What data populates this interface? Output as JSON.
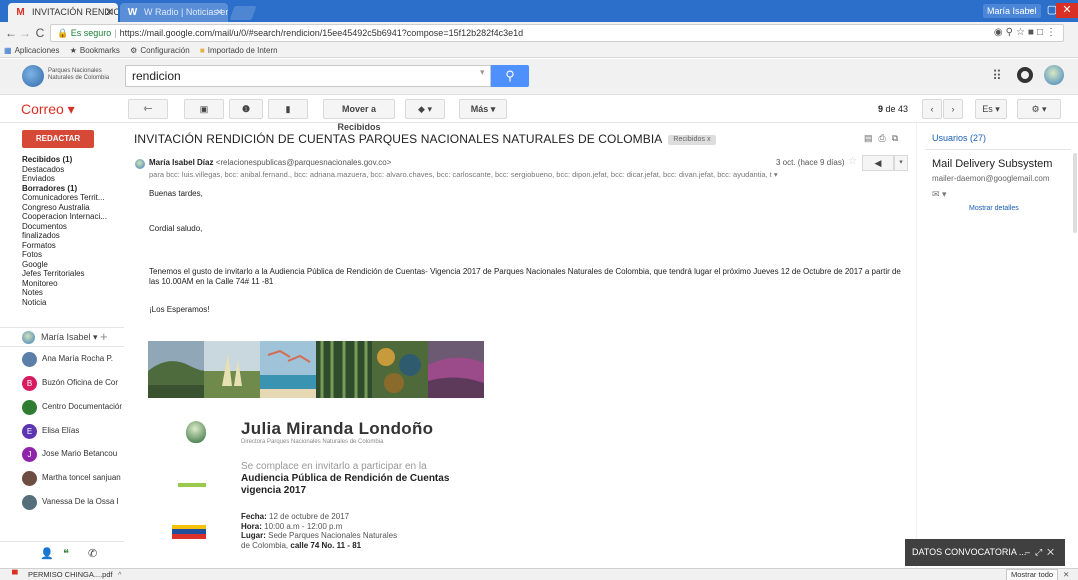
{
  "browser": {
    "tabs": [
      {
        "title": "INVITACIÓN RENDICIÓ",
        "favicon": "M"
      },
      {
        "title": "W Radio | Noticias en Co",
        "favicon": "W"
      }
    ],
    "profile": "María Isabel",
    "window_controls": [
      "–",
      "▢",
      "✕"
    ],
    "secure_label": "Es seguro",
    "url": "https://mail.google.com/mail/u/0/#search/rendicion/15ee45492c5b6941?compose=15f12b282f4c3e1d",
    "bookmarks": [
      "Aplicaciones",
      "Bookmarks",
      "Configuración",
      "Importado de Intern"
    ]
  },
  "gmail": {
    "logo_text": "Parques Nacionales Naturales de Colombia",
    "search_value": "rendicion",
    "app_label": "Correo ▾",
    "toolbar": {
      "move": "Mover a Recibidos",
      "more": "Más ▾",
      "count_range": "9",
      "count_total": "de 43",
      "lang": "Es ▾"
    },
    "compose": "REDACTAR",
    "folders": [
      {
        "label": "Recibidos (1)",
        "bold": true
      },
      {
        "label": "Destacados",
        "bold": false
      },
      {
        "label": "Enviados",
        "bold": false
      },
      {
        "label": "Borradores (1)",
        "bold": true
      },
      {
        "label": "Comunicadores Territ...",
        "bold": false
      },
      {
        "label": "Congreso Australia",
        "bold": false
      },
      {
        "label": "Cooperacion Internaci...",
        "bold": false
      },
      {
        "label": "Documentos",
        "bold": false
      },
      {
        "label": "finalizados",
        "bold": false
      },
      {
        "label": "Formatos",
        "bold": false
      },
      {
        "label": "Fotos",
        "bold": false
      },
      {
        "label": "Google",
        "bold": false
      },
      {
        "label": "Jefes Territoriales",
        "bold": false
      },
      {
        "label": "Monitoreo",
        "bold": false
      },
      {
        "label": "Notes",
        "bold": false
      },
      {
        "label": "Noticia",
        "bold": false
      }
    ],
    "hangouts_me": "María Isabel ▾",
    "contacts": [
      {
        "name": "Ana María Rocha P.",
        "initial": "",
        "color": "#5b7fa8"
      },
      {
        "name": "Buzón Oficina de Cor",
        "initial": "B",
        "color": "#d81b60"
      },
      {
        "name": "Centro Documentación",
        "initial": "",
        "color": "#2e7d32"
      },
      {
        "name": "Elisa Elías",
        "initial": "E",
        "color": "#5e35b1"
      },
      {
        "name": "Jose Mario Betancou",
        "initial": "J",
        "color": "#8e24aa"
      },
      {
        "name": "Martha toncel sanjuan",
        "initial": "",
        "color": "#6d4c41"
      },
      {
        "name": "Vanessa De la Ossa I",
        "initial": "",
        "color": "#546e7a"
      }
    ]
  },
  "message": {
    "subject": "INVITACIÓN RENDICIÓN DE CUENTAS PARQUES NACIONALES NATURALES DE COLOMBIA",
    "label_chip": "Recibidos  x",
    "sender_name": "María Isabel Díaz",
    "sender_email": "<relacionespublicas@parquesnacionales.gov.co>",
    "date": "3 oct. (hace 9 días)",
    "recipients": "para bcc: luis.villegas, bcc: anibal.fernand., bcc: adriana.mazuera, bcc: alvaro.chaves, bcc: carloscante, bcc: sergiobueno, bcc: dipon.jefat, bcc: dicar.jefat, bcc: divan.jefat, bcc: ayudantia, t ▾",
    "greeting": "Buenas tardes,",
    "salutation": "Cordial saludo,",
    "body": "Tenemos el gusto de invitarlo a la Audiencia Pública de Rendición de Cuentas- Vigencia 2017 de Parques Nacionales Naturales de Colombia, que tendrá lugar el próximo Jueves 12 de Octubre de 2017 a partir de las 10.00AM en la Calle 74# 11 -81",
    "closing": "¡Los Esperamos!",
    "invitation": {
      "name": "Julia Miranda Londoño",
      "role": "Directora Parques Nacionales Naturales de Colombia",
      "invite_line": "Se complace en invitarlo a participar en la",
      "event_line1": "Audiencia Pública de Rendición de Cuentas",
      "event_line2": "vigencia 2017",
      "fecha_label": "Fecha:",
      "fecha": "12 de octubre de 2017",
      "hora_label": "Hora:",
      "hora": "10:00 a.m - 12:00 p.m",
      "lugar_label": "Lugar:",
      "lugar1": "Sede Parques Nacionales Naturales",
      "lugar2": "de Colombia,",
      "lugar3": "calle 74 No. 11 - 81"
    }
  },
  "right_panel": {
    "users": "Usuarios (27)",
    "contact_name": "Mail Delivery Subsystem",
    "contact_email": "mailer-daemon@googlemail.com",
    "details_link": "Mostrar detalles"
  },
  "chat": {
    "title": "DATOS CONVOCATORIA ..."
  },
  "downloads": {
    "file": "PERMISO CHINGA....pdf",
    "show_all": "Mostrar todo"
  },
  "colors": {
    "accent_blue": "#4d90fe",
    "compose_red": "#d64937",
    "tab_blue": "#2b6fca"
  }
}
